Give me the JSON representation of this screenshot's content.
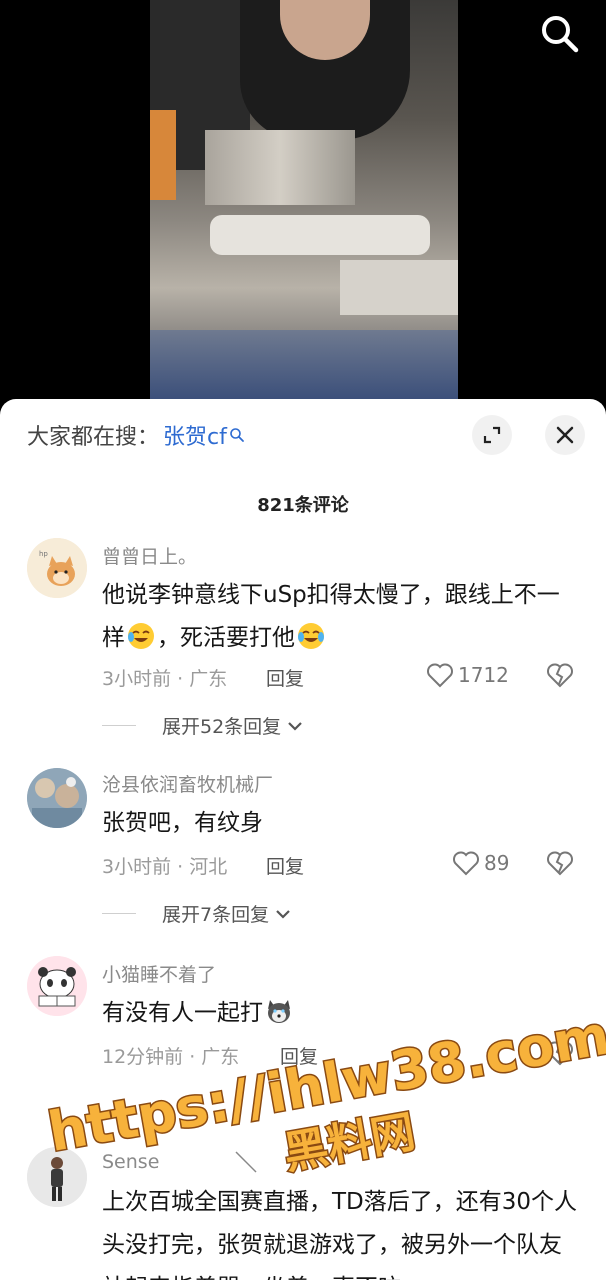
{
  "hot_search": {
    "prefix": "大家都在搜：",
    "term": "张贺cf"
  },
  "comment_count": "821条评论",
  "comments": [
    {
      "username": "曾曾日上。",
      "text_parts": [
        "他说李钟意线下uSp扣得太慢了，跟线上不一样",
        "，死活要打他"
      ],
      "meta": "3小时前 · 广东",
      "reply_label": "回复",
      "likes": "1712",
      "expand_label": "展开52条回复"
    },
    {
      "username": "沧县依润畜牧机械厂",
      "text": "张贺吧，有纹身",
      "meta": "3小时前 · 河北",
      "reply_label": "回复",
      "likes": "89",
      "expand_label": "展开7条回复"
    },
    {
      "username": "小猫睡不着了",
      "text": "有没有人一起打",
      "meta": "12分钟前 · 广东",
      "reply_label": "回复",
      "likes": ""
    },
    {
      "username": "Sense",
      "text": "上次百城全国赛直播，TD落后了，还有30个人头没打完，张贺就退游戏了，被另外一个队友站起来指着骂，坐着一声不吭"
    }
  ],
  "icons": {
    "search": "search-icon",
    "expand": "fullscreen-icon",
    "close": "close-icon",
    "like": "heart-outline-icon",
    "dislike": "broken-heart-icon",
    "chevron": "chevron-down-icon"
  },
  "colors": {
    "link_blue": "#2e6bd1",
    "watermark_fill": "#f7b23b",
    "watermark_stroke": "#8a4a12"
  },
  "watermark": {
    "line1": "https://ihlw38.com",
    "line2": "黑料网"
  }
}
